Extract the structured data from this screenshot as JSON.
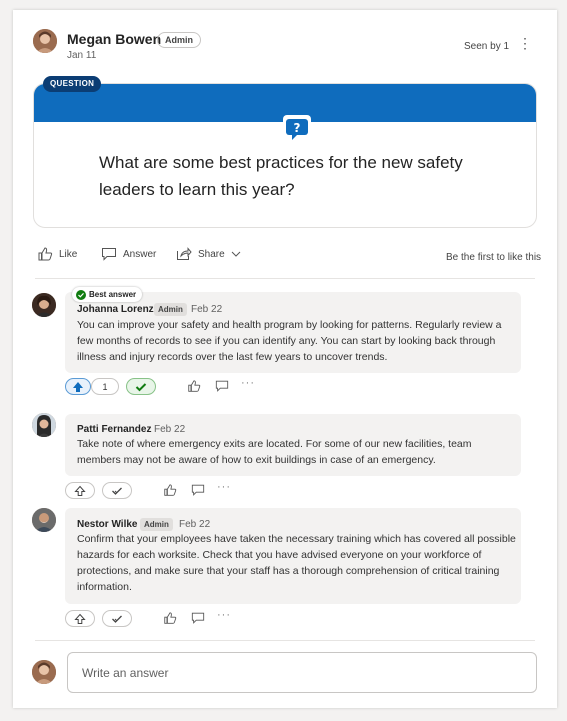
{
  "post": {
    "author": "Megan Bowen",
    "role_badge": "Admin",
    "date": "Jan 11",
    "seen": "Seen by 1",
    "more_glyph": "⋮",
    "question_tag": "QUESTION",
    "question_text": "What are some best practices for the new safety leaders to learn this year?"
  },
  "actions": {
    "like": "Like",
    "answer": "Answer",
    "share": "Share",
    "first_like": "Be the first to like this"
  },
  "replies": [
    {
      "name": "Johanna Lorenz",
      "badge": "Admin",
      "date": "Feb 22",
      "best_answer": "Best answer",
      "text": "You can improve your safety and health program by looking for patterns. Regularly review a few months of records to see if you can identify any. You can start by looking back through illness and injury records over the last few years to uncover trends.",
      "upvotes": "1",
      "more_glyph": "···"
    },
    {
      "name": "Patti Fernandez",
      "date": "Feb 22",
      "text": "Take note of where emergency exits are located. For some of our new facilities, team members may not be aware of how to exit buildings in case of an emergency.",
      "more_glyph": "···"
    },
    {
      "name": "Nestor Wilke",
      "badge": "Admin",
      "date": "Feb 22",
      "text": "Confirm that your employees have taken the necessary training which has covered all possible hazards for each worksite. Check that you have advised everyone on your workforce of protections, and make sure that your staff has a thorough comprehension of critical training information.",
      "more_glyph": "···"
    }
  ],
  "composer": {
    "placeholder": "Write an answer"
  },
  "colors": {
    "accent": "#0f6cbd",
    "tag_bg": "#0b3d74",
    "accepted_green": "#107c10",
    "reply_bg": "#f3f2f1"
  },
  "icons": [
    "more-vertical-icon",
    "question-chat-icon",
    "like-icon",
    "answer-icon",
    "share-icon",
    "chevron-down-icon",
    "checkmark-circle-icon",
    "upvote-arrow-icon",
    "checkmark-icon",
    "comment-icon"
  ]
}
